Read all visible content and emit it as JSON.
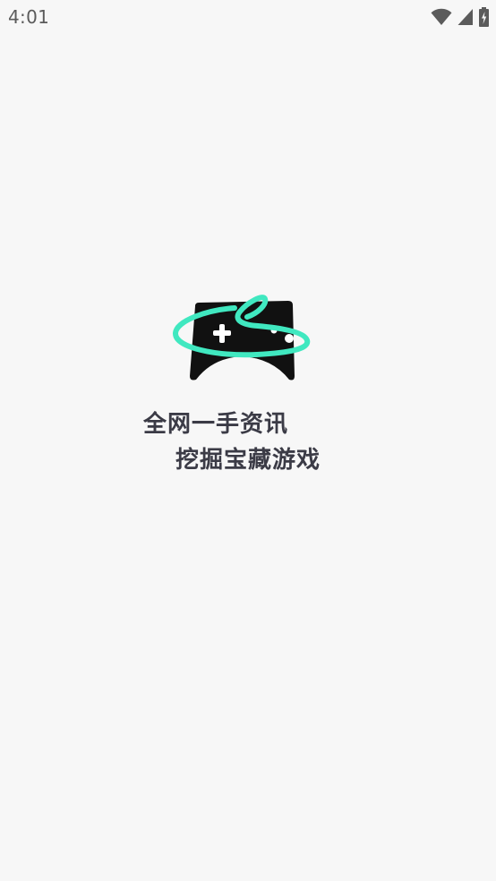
{
  "status_bar": {
    "time": "4:01",
    "icons": [
      "wifi-icon",
      "signal-icon",
      "battery-charging-icon"
    ]
  },
  "splash": {
    "logo": "gamepad-logo",
    "slogan_line1": "全网一手资讯",
    "slogan_line2": "挖掘宝藏游戏"
  },
  "colors": {
    "background": "#f7f7f7",
    "accent": "#40e8c0",
    "text": "#3b3b46",
    "logo_body": "#111111"
  }
}
